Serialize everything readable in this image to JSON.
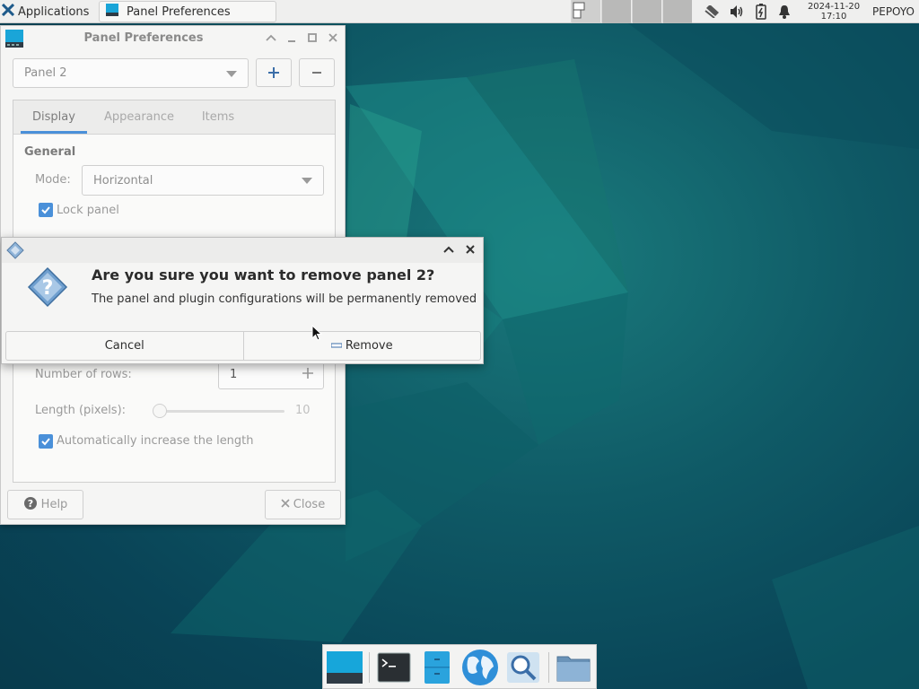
{
  "top_panel": {
    "applications_label": "Applications",
    "task_title": "Panel Preferences",
    "clock_date": "2024-11-20",
    "clock_time": "17:10",
    "username": "PEPOYO"
  },
  "pref_window": {
    "title": "Panel Preferences",
    "panel_selected": "Panel 2",
    "tabs": [
      "Display",
      "Appearance",
      "Items"
    ],
    "active_tab": "Display",
    "section_general": "General",
    "mode_label": "Mode:",
    "mode_value": "Horizontal",
    "lock_panel_label": "Lock panel",
    "rows_label": "Number of rows:",
    "rows_value": "1",
    "length_label": "Length (pixels):",
    "length_value": "10",
    "auto_length_label": "Automatically increase the length",
    "help_label": "Help",
    "close_label": "Close"
  },
  "dialog": {
    "heading": "Are you sure you want to remove panel 2?",
    "message": "The panel and plugin configurations will be permanently removed",
    "cancel_label": "Cancel",
    "remove_label": "Remove"
  },
  "dock": {
    "items": [
      "show-desktop-icon",
      "terminal-icon",
      "file-manager-icon",
      "web-browser-icon",
      "app-finder-icon",
      "folder-icon"
    ]
  },
  "colors": {
    "accent": "#4a90d9",
    "desktop": "#0b4a59",
    "panel_bg": "#efefee"
  }
}
